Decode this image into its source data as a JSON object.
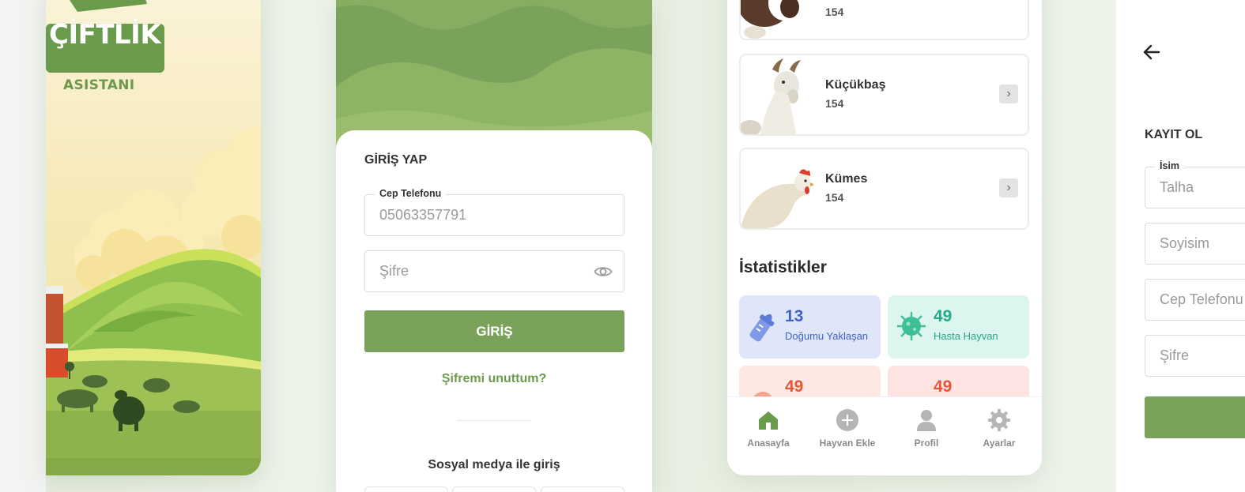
{
  "splash": {
    "logo_title": "ÇİFTLİK",
    "logo_subtitle": "ASISTANI"
  },
  "login": {
    "title": "GİRİŞ YAP",
    "phone_field": {
      "label": "Cep Telefonu",
      "value": "05063357791"
    },
    "password_field": {
      "placeholder": "Şifre"
    },
    "submit_label": "GİRİŞ",
    "forgot_label": "Şifremi unuttum?",
    "social_label": "Sosyal medya ile giriş"
  },
  "home": {
    "partial_card": {
      "count": "154"
    },
    "animals": [
      {
        "name": "Küçükbaş",
        "count": "154"
      },
      {
        "name": "Kümes",
        "count": "154"
      }
    ],
    "stats_title": "İstatistikler",
    "stats": [
      {
        "value": "13",
        "label": "Doğumu Yaklaşan",
        "bg": "#dfe6fa",
        "color": "#3e63c8"
      },
      {
        "value": "49",
        "label": "Hasta Hayvan",
        "bg": "#dcf5ef",
        "color": "#25a98a"
      },
      {
        "value": "49",
        "label": "",
        "bg": "#fde9e1",
        "color": "#e4553a"
      },
      {
        "value": "49",
        "label": "",
        "bg": "#fde4e2",
        "color": "#e4553a"
      }
    ],
    "tabs": [
      {
        "label": "Anasayfa",
        "icon": "home-icon",
        "active": true
      },
      {
        "label": "Hayvan Ekle",
        "icon": "plus-circle-icon",
        "active": false
      },
      {
        "label": "Profil",
        "icon": "user-icon",
        "active": false
      },
      {
        "label": "Ayarlar",
        "icon": "gear-icon",
        "active": false
      }
    ]
  },
  "register": {
    "title": "KAYIT OL",
    "name_field": {
      "label": "İsim",
      "value": "Talha"
    },
    "surname_placeholder": "Soyisim",
    "phone_placeholder": "Cep Telefonu",
    "password_placeholder": "Şifre"
  },
  "colors": {
    "brand_green": "#7aa25a",
    "link_green": "#6c9b4a"
  }
}
